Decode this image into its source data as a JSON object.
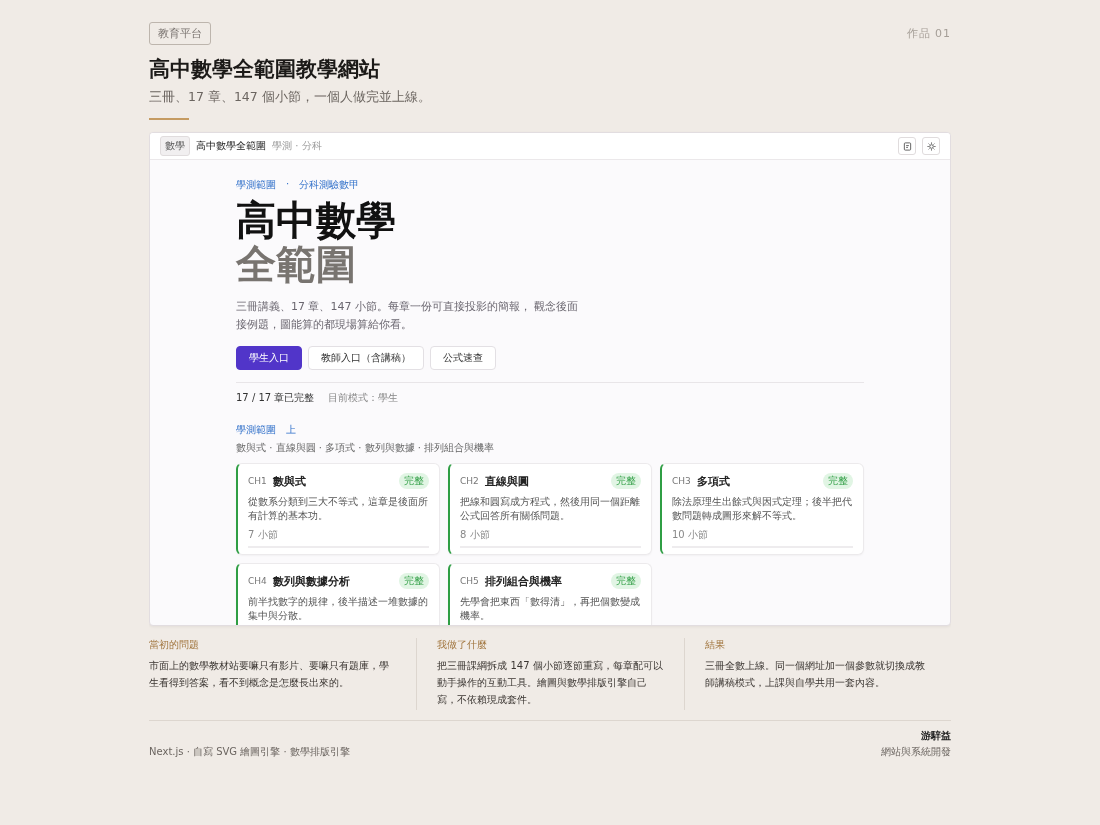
{
  "category_tag": "教育平台",
  "work_number": "作品 01",
  "title": "高中數學全範圍教學網站",
  "subtitle": "三冊、17 章、147 個小節，一個人做完並上線。",
  "preview": {
    "topbar": {
      "badge": "數學",
      "site_name": "高中數學全範圍",
      "site_sub": "學測 · 分科"
    },
    "eyebrow": [
      "學測範圍",
      "·",
      "分科測驗數甲"
    ],
    "hero_title": [
      "高中數學",
      "全範圍"
    ],
    "intro": "三冊講義、17 章、147 小節。每章一份可直接投影的簡報， 觀念後面接例題，圖能算的都現場算給你看。",
    "buttons": [
      {
        "label": "學生入口",
        "primary": true
      },
      {
        "label": "教師入口（含講稿）",
        "primary": false
      },
      {
        "label": "公式速查",
        "primary": false
      }
    ],
    "stats": [
      "17 / 17 章已完整",
      "目前模式：學生"
    ],
    "section": {
      "title": "學測範圍",
      "volume": "上",
      "topics": "數與式 · 直線與圓 · 多項式 · 數列與數據 · 排列組合與機率"
    },
    "chapters": [
      {
        "code": "CH1",
        "name": "數與式",
        "status": "完整",
        "complete": true,
        "desc": "從數系分類到三大不等式，這章是後面所有計算的基本功。",
        "count": "7 小節"
      },
      {
        "code": "CH2",
        "name": "直線與圓",
        "status": "完整",
        "complete": true,
        "desc": "把線和圓寫成方程式，然後用同一個距離公式回答所有關係問題。",
        "count": "8 小節"
      },
      {
        "code": "CH3",
        "name": "多項式",
        "status": "完整",
        "complete": true,
        "desc": "除法原理生出餘式與因式定理；後半把代數問題轉成圖形來解不等式。",
        "count": "10 小節"
      },
      {
        "code": "CH4",
        "name": "數列與數據分析",
        "status": "完整",
        "complete": true,
        "desc": "前半找數字的規律，後半描述一堆數據的集中與分散。"
      },
      {
        "code": "CH5",
        "name": "排列組合與機率",
        "status": "完整",
        "complete": true,
        "desc": "先學會把東西「數得清」，再把個數變成機率。"
      }
    ]
  },
  "columns": [
    {
      "heading": "當初的問題",
      "text": "市面上的數學教材站要嘛只有影片、要嘛只有題庫，學生看得到答案，看不到概念是怎麼長出來的。"
    },
    {
      "heading": "我做了什麼",
      "text": "把三冊課綱拆成 147 個小節逐節重寫，每章配可以動手操作的互動工具。繪圖與數學排版引擎自己寫，不依賴現成套件。"
    },
    {
      "heading": "結果",
      "text": "三冊全數上線。同一個網址加一個參數就切換成教師講稿模式，上課與自學共用一套內容。"
    }
  ],
  "footer": {
    "stack": "Next.js · 自寫 SVG 繪圖引擎 · 數學排版引擎",
    "author": "游騂益",
    "role": "網站與系統開發"
  }
}
